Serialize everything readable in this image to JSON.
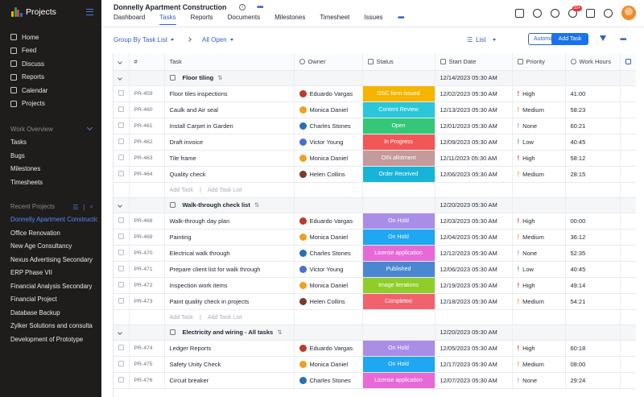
{
  "sidebar": {
    "app_name": "Projects",
    "nav": [
      {
        "label": "Home",
        "icon": "home-icon"
      },
      {
        "label": "Feed",
        "icon": "feed-icon"
      },
      {
        "label": "Discuss",
        "icon": "discuss-icon"
      },
      {
        "label": "Reports",
        "icon": "reports-icon"
      },
      {
        "label": "Calendar",
        "icon": "calendar-icon"
      },
      {
        "label": "Projects",
        "icon": "projects-icon"
      }
    ],
    "work_overview": {
      "title": "Work Overview",
      "items": [
        "Tasks",
        "Bugs",
        "Milestones",
        "Timesheets"
      ]
    },
    "recent_projects": {
      "title": "Recent Projects",
      "items": [
        "Donnelly Apartment Construction",
        "Office Renovation",
        "New Age Consultancy",
        "Nexus Advertising Secondary",
        "ERP Phase VII",
        "Financial Analysis Secondary",
        "Financial  Project",
        "Database Backup",
        "Zylker Solutions and consulta",
        "Development of Prototype"
      ]
    }
  },
  "header": {
    "project_title": "Donnelly Apartment Construction",
    "tabs": [
      "Dashboard",
      "Tasks",
      "Reports",
      "Documents",
      "Milestones",
      "Timesheet",
      "Issues"
    ],
    "active_tab": "Tasks",
    "notification_count": "10+"
  },
  "toolbar": {
    "group_by": "Group By Task List",
    "filter_view": "All Open",
    "view_mode": "List",
    "automation_label": "Automation",
    "add_task_label": "Add Task"
  },
  "table": {
    "columns": [
      "#",
      "Task",
      "Owner",
      "Status",
      "Start Date",
      "Priority",
      "Work Hours"
    ],
    "add_task_label": "Add Task",
    "add_task_list_label": "Add Task List",
    "groups": [
      {
        "name": "Floor tiling",
        "start_date": "12/14/2023 05:30 AM",
        "rows": [
          {
            "id": "PR-459",
            "task": "Floor tiles inspections",
            "owner": "Eduardo Vargas",
            "status": "DSC form issued",
            "status_color": "#f5b400",
            "start": "12/02/2023 05:30 AM",
            "priority": "High",
            "hours": "41:00"
          },
          {
            "id": "PR-460",
            "task": "Caulk and Air seal",
            "owner": "Monica Daniel",
            "status": "Content Review",
            "status_color": "#2bc6d9",
            "start": "12/13/2023 05:30 AM",
            "priority": "Medium",
            "hours": "58:23"
          },
          {
            "id": "PR-461",
            "task": "Install Carpet in Garden",
            "owner": "Charles Stones",
            "status": "Open",
            "status_color": "#34c779",
            "start": "12/01/2023 05:30 AM",
            "priority": "None",
            "hours": "60:21"
          },
          {
            "id": "PR-462",
            "task": "Draft invoice",
            "owner": "Victor Young",
            "status": "In Progress",
            "status_color": "#f25757",
            "start": "12/09/2023 05:30 AM",
            "priority": "Low",
            "hours": "40:45"
          },
          {
            "id": "PR-463",
            "task": "Tile frame",
            "owner": "Monica Daniel",
            "status": "OIN allotment",
            "status_color": "#c59a9a",
            "start": "12/11/2023 05:30 AM",
            "priority": "High",
            "hours": "58:12"
          },
          {
            "id": "PR-464",
            "task": "Quality check",
            "owner": "Helen Collins",
            "status": "Order Received",
            "status_color": "#17b4d8",
            "start": "12/06/2023 05:30 AM",
            "priority": "Medium",
            "hours": "28:15"
          }
        ]
      },
      {
        "name": "Walk-through check list",
        "start_date": "12/20/2023 05:30 AM",
        "rows": [
          {
            "id": "PR-468",
            "task": "Walk-through day plan",
            "owner": "Eduardo Vargas",
            "status": "On Hold",
            "status_color": "#a98ee8",
            "start": "12/03/2023 05:30 AM",
            "priority": "High",
            "hours": "00:00"
          },
          {
            "id": "PR-469",
            "task": "Painting",
            "owner": "Monica Daniel",
            "status": "On Hold",
            "status_color": "#1ea7f2",
            "start": "12/04/2023 05:30 AM",
            "priority": "Medium",
            "hours": "36:12"
          },
          {
            "id": "PR-470",
            "task": "Electrical walk through",
            "owner": "Charles Stones",
            "status": "License application",
            "status_color": "#e769d8",
            "start": "12/12/2023 05:30 AM",
            "priority": "None",
            "hours": "52:35"
          },
          {
            "id": "PR-471",
            "task": "Prepare client list for walk through",
            "owner": "Victor Young",
            "status": "Published",
            "status_color": "#4b86d0",
            "start": "12/06/2023 05:30 AM",
            "priority": "Low",
            "hours": "40:45"
          },
          {
            "id": "PR-472",
            "task": "Inspection work items",
            "owner": "Monica Daniel",
            "status": "Image iterations",
            "status_color": "#8fce2a",
            "start": "12/19/2023 05:30 AM",
            "priority": "High",
            "hours": "49:14"
          },
          {
            "id": "PR-473",
            "task": "Paint quality check in projects",
            "owner": "Helen Collins",
            "status": "Completed",
            "status_color": "#f2626d",
            "start": "12/18/2023 05:30 AM",
            "priority": "Medium",
            "hours": "54:21"
          }
        ]
      },
      {
        "name": "Electricity and wiring - All tasks",
        "start_date": "12/20/2023 05:30 AM",
        "rows": [
          {
            "id": "PR-474",
            "task": "Ledger Reports",
            "owner": "Eduardo Vargas",
            "status": "On Hold",
            "status_color": "#a98ee8",
            "start": "12/05/2023 05:30 AM",
            "priority": "High",
            "hours": "60:18"
          },
          {
            "id": "PR-475",
            "task": "Safety Unity Check",
            "owner": "Monica Daniel",
            "status": "On Hold",
            "status_color": "#1ea7f2",
            "start": "12/17/2023 05:30 AM",
            "priority": "Medium",
            "hours": "08:00"
          },
          {
            "id": "PR-476",
            "task": "Circuit breaker",
            "owner": "Charles Stones",
            "status": "License application",
            "status_color": "#e769d8",
            "start": "12/07/2023 05:30 AM",
            "priority": "None",
            "hours": "29:24"
          }
        ]
      }
    ]
  },
  "priority_colors": {
    "High": "#e0363a",
    "Medium": "#f0a020",
    "Low": "#3ab54a",
    "None": "#9aa0aa"
  },
  "owner_colors": {
    "Eduardo Vargas": "#c0392b",
    "Monica Daniel": "#f0a020",
    "Charles Stones": "#2a6fb5",
    "Victor Young": "#4a6fd0",
    "Helen Collins": "#7a3b2e"
  }
}
